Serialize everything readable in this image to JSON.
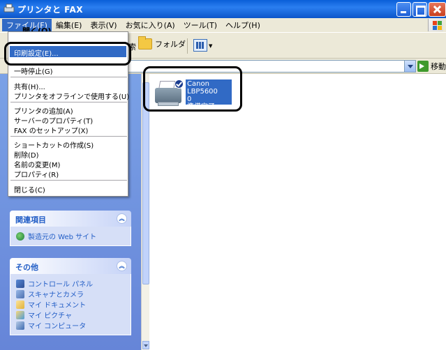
{
  "window": {
    "title": "プリンタと FAX"
  },
  "menubar": {
    "items": [
      "ファイル(F)",
      "編集(E)",
      "表示(V)",
      "お気に入り(A)",
      "ツール(T)",
      "ヘルプ(H)"
    ]
  },
  "toolbar": {
    "search_partial": "索",
    "folders_label": "フォルダ"
  },
  "addressbar": {
    "go_label": "移動"
  },
  "file_menu": {
    "peek_label": "開く(O)",
    "items": [
      "印刷設定(E)...",
      "一時停止(G)",
      "共有(H)...",
      "プリンタをオフラインで使用する(U)",
      "プリンタの追加(A)",
      "サーバーのプロパティ(T)",
      "FAX のセットアップ(X)",
      "ショートカットの作成(S)",
      "削除(D)",
      "名前の変更(M)",
      "プロパティ(R)",
      "閉じる(C)"
    ]
  },
  "taskpane": {
    "related": {
      "title": "関連項目",
      "links": [
        "製造元の Web サイト"
      ]
    },
    "other": {
      "title": "その他",
      "links": [
        "コントロール パネル",
        "スキャナとカメラ",
        "マイ ドキュメント",
        "マイ ピクチャ",
        "マイ コンピュータ"
      ]
    }
  },
  "printer": {
    "name_line1": "Canon LBP5600",
    "name_line2": "0",
    "status": "準備完了"
  },
  "colors": {
    "accent": "#316ac5",
    "title_bar": "#0a5fd8",
    "pane_bg": "#6f93dd",
    "link": "#215dc6"
  }
}
